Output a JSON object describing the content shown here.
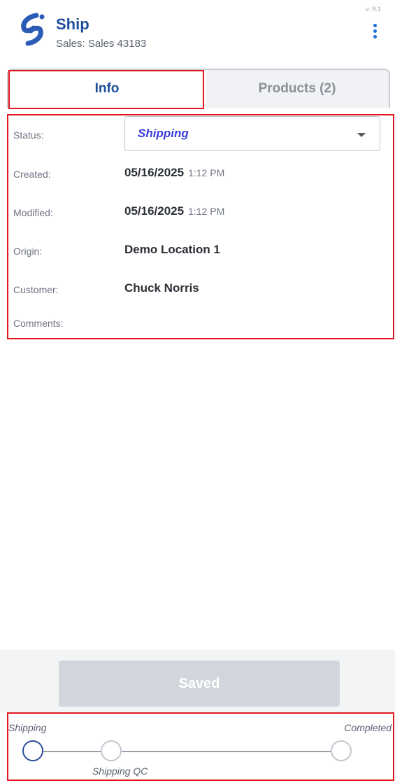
{
  "header": {
    "title": "Ship",
    "subtitle": "Sales: Sales 43183",
    "version": "v: 8.1"
  },
  "tabs": [
    {
      "label": "Info",
      "active": true
    },
    {
      "label": "Products (2)",
      "active": false
    }
  ],
  "details": {
    "status_label": "Status:",
    "status_value": "Shipping",
    "created_label": "Created:",
    "created_date": "05/16/2025",
    "created_time": "1:12 PM",
    "modified_label": "Modified:",
    "modified_date": "05/16/2025",
    "modified_time": "1:12 PM",
    "origin_label": "Origin:",
    "origin_value": "Demo Location 1",
    "customer_label": "Customer:",
    "customer_value": "Chuck Norris",
    "comments_label": "Comments:"
  },
  "actions": {
    "saved_label": "Saved"
  },
  "progress": {
    "steps": [
      {
        "label": "Shipping",
        "state": "current"
      },
      {
        "label": "Shipping QC",
        "state": "pending"
      },
      {
        "label": "Completed",
        "state": "pending"
      }
    ]
  },
  "colors": {
    "brand": "#1f4e9c",
    "accent": "#1e6fd9",
    "status_text": "#3b3fe0",
    "highlight": "#e0191f"
  },
  "icons": {
    "logo": "app-logo-icon",
    "menu": "more-vertical-icon",
    "dropdown": "chevron-down-icon"
  }
}
